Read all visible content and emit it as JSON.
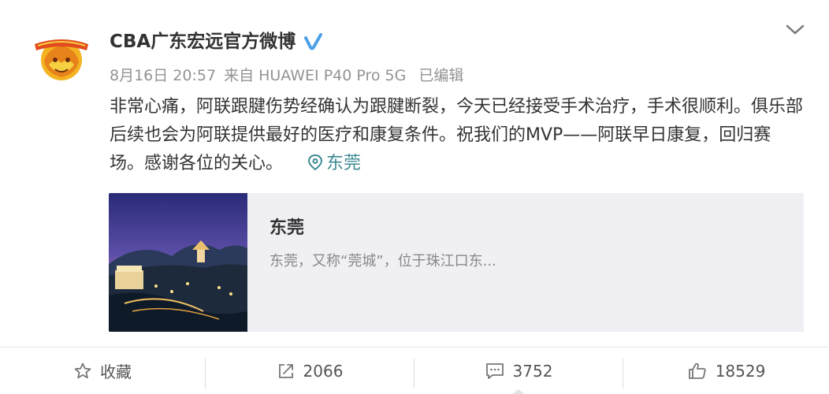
{
  "post": {
    "author": "CBA广东宏远官方微博",
    "date": "8月16日 20:57",
    "source": "来自 HUAWEI P40 Pro 5G",
    "edited": "已编辑",
    "text": "非常心痛，阿联跟腱伤势经确认为跟腱断裂，今天已经接受手术治疗，手术很顺利。俱乐部后续也会为阿联提供最好的医疗和康复条件。祝我们的MVP——阿联早日康复，回归赛场。感谢各位的关心。",
    "location": "东莞"
  },
  "card": {
    "title": "东莞",
    "description": "东莞，又称“莞城”，位于珠江口东..."
  },
  "actions": {
    "favorite": "收藏",
    "reposts": "2066",
    "comments": "3752",
    "likes": "18529"
  },
  "colors": {
    "verified_badge": "#4fa0e8",
    "location_link": "#3e8a92",
    "card_background": "#f0f0f4"
  },
  "icons": [
    "avatar-logo",
    "verified-badge-icon",
    "chevron-down-icon",
    "location-pin-icon",
    "star-icon",
    "repost-icon",
    "comment-icon",
    "thumbs-up-icon"
  ]
}
